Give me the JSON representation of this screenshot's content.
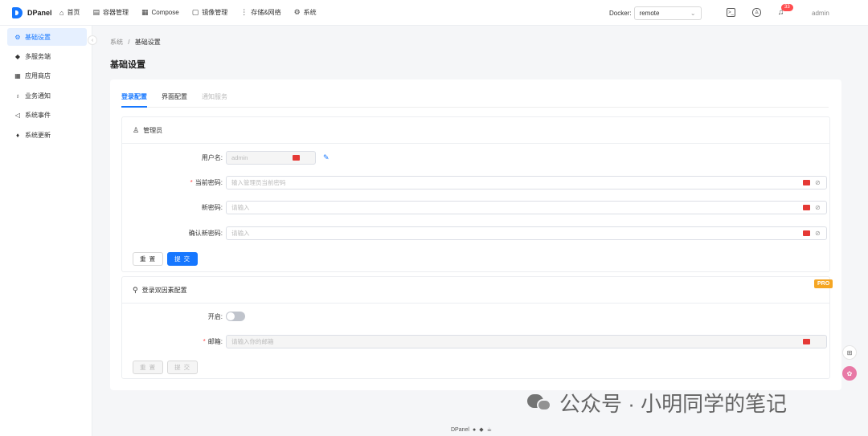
{
  "app": {
    "name": "DPanel"
  },
  "nav": [
    {
      "icon": "home-icon",
      "glyph": "⌂",
      "label": "首页"
    },
    {
      "icon": "container-icon",
      "glyph": "▤",
      "label": "容器管理"
    },
    {
      "icon": "compose-icon",
      "glyph": "▦",
      "label": "Compose"
    },
    {
      "icon": "image-icon",
      "glyph": "▢",
      "label": "镜像管理"
    },
    {
      "icon": "storage-icon",
      "glyph": "⋮",
      "label": "存储&网络"
    },
    {
      "icon": "system-icon",
      "glyph": "⚙",
      "label": "系统"
    }
  ],
  "docker": {
    "label": "Docker:",
    "value": "remote"
  },
  "notifications": {
    "count": "33"
  },
  "user": {
    "name": "admin"
  },
  "sidebar": [
    {
      "icon": "settings-icon",
      "glyph": "⚙",
      "label": "基础设置",
      "active": true
    },
    {
      "icon": "docker-icon",
      "glyph": "◆",
      "label": "多服务端"
    },
    {
      "icon": "app-store-icon",
      "glyph": "▦",
      "label": "应用商店"
    },
    {
      "icon": "bell-icon",
      "glyph": "♁",
      "label": "业务通知"
    },
    {
      "icon": "megaphone-icon",
      "glyph": "◁",
      "label": "系统事件"
    },
    {
      "icon": "update-icon",
      "glyph": "♦",
      "label": "系统更新"
    }
  ],
  "breadcrumb": {
    "parent": "系统",
    "separator": "/",
    "current": "基础设置"
  },
  "page": {
    "title": "基础设置"
  },
  "tabs": [
    {
      "label": "登录配置",
      "state": "active"
    },
    {
      "label": "界面配置",
      "state": "normal"
    },
    {
      "label": "通知服务",
      "state": "disabled"
    }
  ],
  "admin_section": {
    "title": "管理员",
    "username": {
      "label": "用户名:",
      "value": "admin"
    },
    "current_password": {
      "label": "当前密码:",
      "placeholder": "输入管理员当前密码"
    },
    "new_password": {
      "label": "新密码:",
      "placeholder": "请输入"
    },
    "confirm_password": {
      "label": "确认新密码:",
      "placeholder": "请输入"
    },
    "reset_label": "重 置",
    "submit_label": "提 交"
  },
  "twofa_section": {
    "title": "登录双因素配置",
    "badge": "PRO",
    "enable": {
      "label": "开启:"
    },
    "email": {
      "label": "邮箱:",
      "placeholder": "请输入你的邮箱"
    },
    "reset_label": "重 置",
    "submit_label": "提 交"
  },
  "footer": {
    "text": "DPanel"
  },
  "watermark": {
    "text": "公众号 · 小明同学的笔记"
  }
}
